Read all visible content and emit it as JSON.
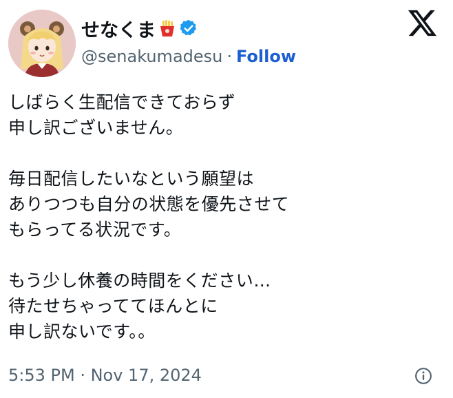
{
  "post": {
    "author": {
      "display_name": "せなくま",
      "handle": "@senakumadesu",
      "separator": "·",
      "follow_label": "Follow",
      "badge_icon": "verified-badge-icon",
      "emoji_icon": "french-fries-emoji-icon"
    },
    "text": "しばらく生配信できておらず\n申し訳ございません。\n\n毎日配信したいなという願望は\nありつつも自分の状態を優先させて\nもらってる状況です。\n\nもう少し休養の時間をください…\n待たせちゃっててほんとに\n申し訳ないです。。",
    "timestamp": "5:53 PM · Nov 17, 2024"
  },
  "brand": {
    "logo_icon": "x-logo-icon"
  },
  "colors": {
    "text": "#0f1419",
    "secondary": "#536471",
    "link": "#1d5fd1",
    "verified": "#1d9bf0",
    "avatar_bg": "#e9c9c6"
  }
}
